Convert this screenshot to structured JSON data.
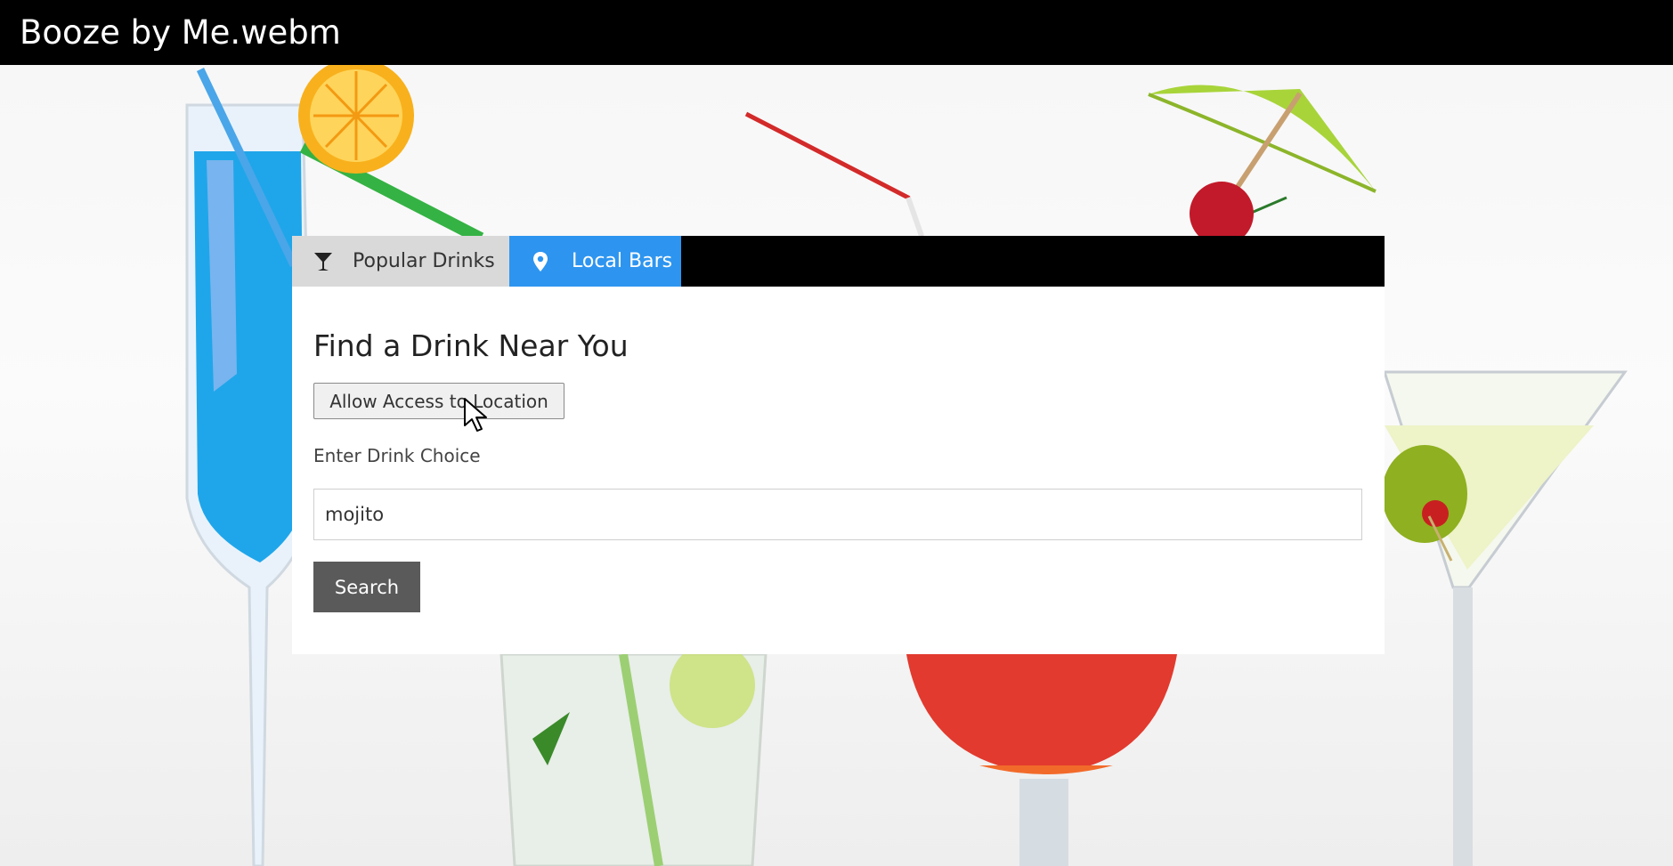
{
  "video": {
    "title": "Booze by Me.webm"
  },
  "tabs": [
    {
      "label": "Popular Drinks",
      "icon": "cocktail-glass-icon",
      "active": false
    },
    {
      "label": "Local Bars",
      "icon": "map-pin-icon",
      "active": true
    }
  ],
  "main": {
    "heading": "Find a Drink Near You",
    "location_button_label": "Allow Access to Location",
    "drink_label": "Enter Drink Choice",
    "drink_input_value": "mojito",
    "search_button_label": "Search"
  },
  "colors": {
    "active_tab": "#2d95f0",
    "inactive_tab": "#d9d9d9",
    "search_button": "#5a5a5a",
    "title_bar": "#000000"
  }
}
